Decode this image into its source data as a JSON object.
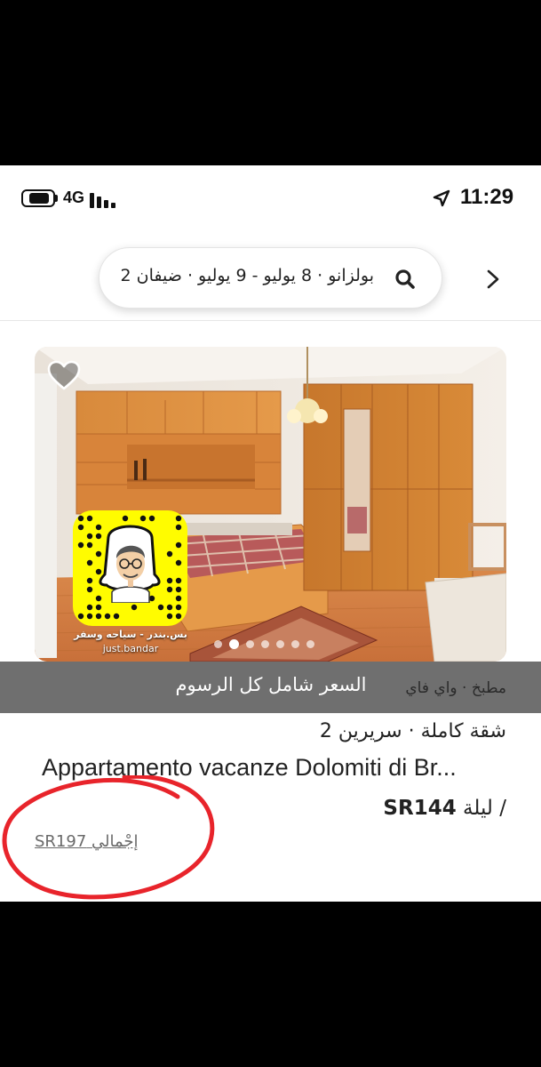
{
  "status_bar": {
    "network": "4G",
    "time": "11:29"
  },
  "search": {
    "summary": "بولزانو · 8 يوليو - 9 يوليو · ضيفان 2"
  },
  "listing": {
    "image_caption": "السعر شامل كل الرسوم",
    "amenities": "مطبخ · واي فاي",
    "property_type": "شقة كاملة · سريرين 2",
    "title": "Appartamento vacanze Dolomiti di Br...",
    "price_amount": "SR144",
    "price_unit": "/ ليلة",
    "total_label": "إجْمالي SR197",
    "photo_count": 7,
    "active_photo_index": 1
  },
  "overlay": {
    "snapcode_caption": "بس.بندر - سياحه وسفر",
    "snapcode_handle": "just.bandar"
  },
  "colors": {
    "accent": "#222222",
    "banner": "#6f6f6f",
    "annotation": "#e8242b",
    "snap": "#fffc00"
  },
  "icons": [
    "battery-icon",
    "signal-bars-icon",
    "location-arrow-icon",
    "search-icon",
    "chevron-right-icon",
    "heart-icon"
  ]
}
